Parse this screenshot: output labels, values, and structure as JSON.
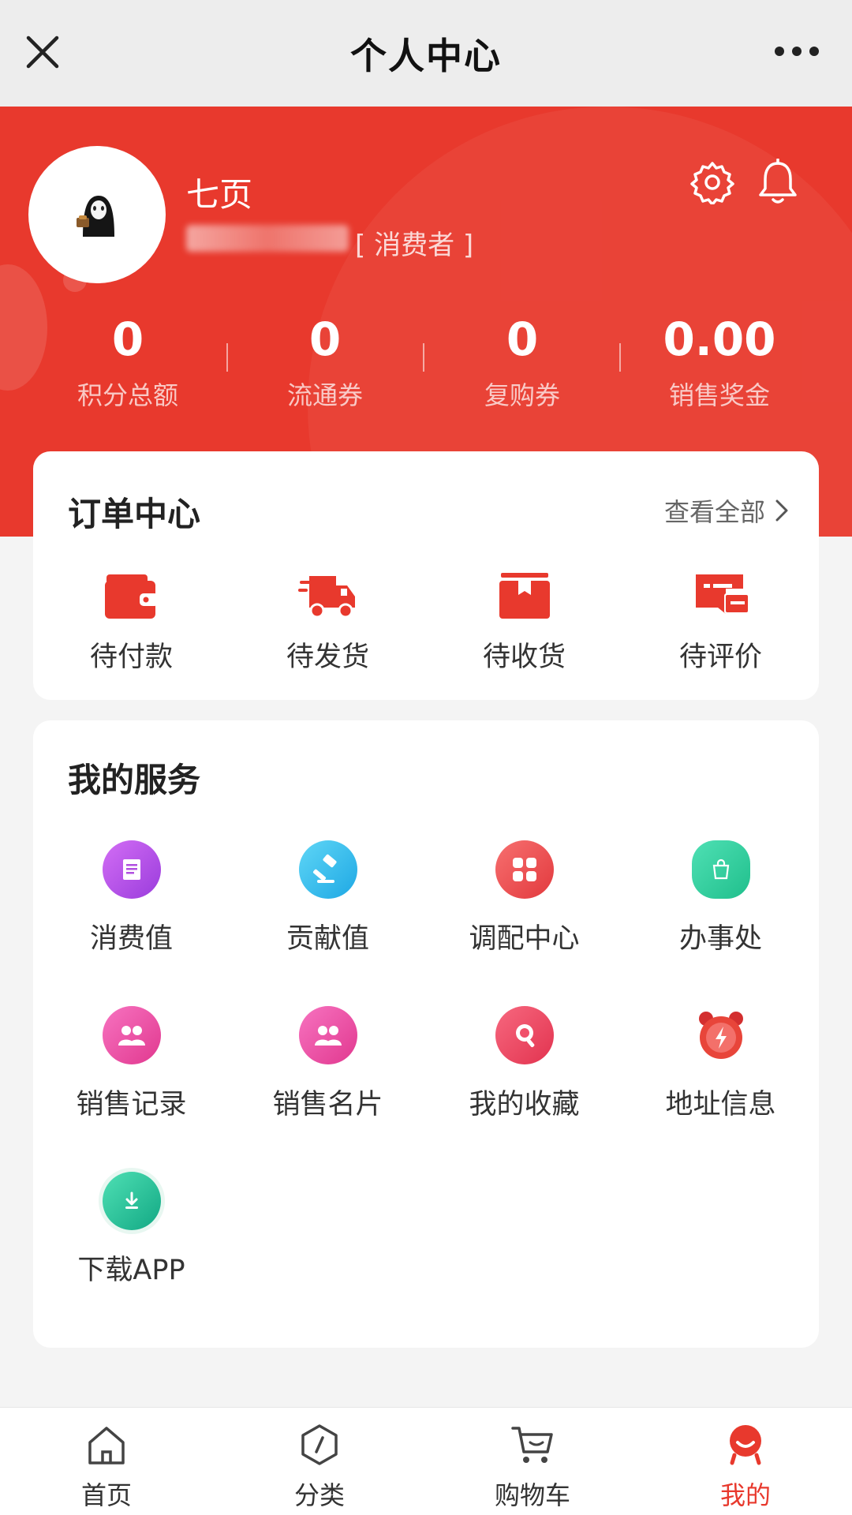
{
  "navbar": {
    "title": "个人中心"
  },
  "profile": {
    "name": "七页",
    "role": "[ 消费者 ]"
  },
  "stats": [
    {
      "value": "0",
      "label": "积分总额"
    },
    {
      "value": "0",
      "label": "流通券"
    },
    {
      "value": "0",
      "label": "复购券"
    },
    {
      "value": "0.00",
      "label": "销售奖金"
    }
  ],
  "orders": {
    "title": "订单中心",
    "view_all": "查看全部",
    "items": [
      {
        "label": "待付款",
        "icon": "wallet-icon"
      },
      {
        "label": "待发货",
        "icon": "delivery-truck-icon"
      },
      {
        "label": "待收货",
        "icon": "package-box-icon"
      },
      {
        "label": "待评价",
        "icon": "review-card-icon"
      }
    ]
  },
  "services": {
    "title": "我的服务",
    "items": [
      {
        "label": "消费值",
        "icon": "document-icon",
        "color": "#b04fe0"
      },
      {
        "label": "贡献值",
        "icon": "gavel-icon",
        "color": "#2bb9ea"
      },
      {
        "label": "调配中心",
        "icon": "grid-icon",
        "color": "#ef4c4c"
      },
      {
        "label": "办事处",
        "icon": "shopping-bag-icon",
        "color": "#34d09f"
      },
      {
        "label": "销售记录",
        "icon": "users-icon",
        "color": "#ee4ea3"
      },
      {
        "label": "销售名片",
        "icon": "users-icon",
        "color": "#ee4ea3"
      },
      {
        "label": "我的收藏",
        "icon": "search-icon",
        "color": "#ee3e60"
      },
      {
        "label": "地址信息",
        "icon": "alarm-clock-icon",
        "color": "#e8453a"
      },
      {
        "label": "下载APP",
        "icon": "download-icon",
        "color": "#22c49a"
      }
    ]
  },
  "tabbar": {
    "items": [
      {
        "label": "首页",
        "icon": "home-icon"
      },
      {
        "label": "分类",
        "icon": "category-icon"
      },
      {
        "label": "购物车",
        "icon": "cart-icon"
      },
      {
        "label": "我的",
        "icon": "profile-icon",
        "active": true
      }
    ]
  },
  "colors": {
    "brand_red": "#e8392d",
    "background": "#f4f4f4",
    "card": "#ffffff"
  }
}
